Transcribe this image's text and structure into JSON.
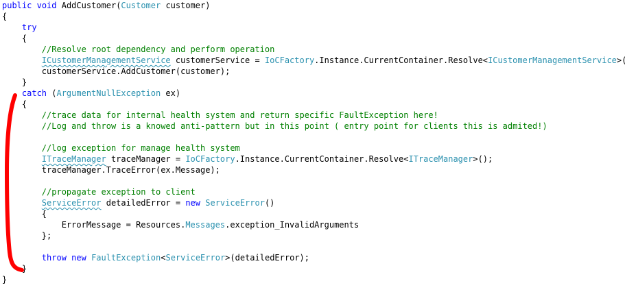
{
  "editor": {
    "indent": "    ",
    "lines": [
      {
        "i": 0,
        "t": [
          {
            "c": "kw",
            "v": "public"
          },
          {
            "v": " "
          },
          {
            "c": "kw",
            "v": "void"
          },
          {
            "v": " AddCustomer("
          },
          {
            "c": "ty",
            "v": "Customer"
          },
          {
            "v": " customer)"
          }
        ]
      },
      {
        "i": 0,
        "t": [
          {
            "v": "{"
          }
        ]
      },
      {
        "i": 1,
        "t": [
          {
            "c": "kw",
            "v": "try"
          }
        ]
      },
      {
        "i": 1,
        "t": [
          {
            "v": "{"
          }
        ]
      },
      {
        "i": 2,
        "t": [
          {
            "c": "cm",
            "v": "//Resolve root dependency and perform operation"
          }
        ]
      },
      {
        "i": 2,
        "t": [
          {
            "c": "ty wavy",
            "v": "ICustomerManagementService"
          },
          {
            "v": " customerService = "
          },
          {
            "c": "ty",
            "v": "IoCFactory"
          },
          {
            "v": ".Instance.CurrentContainer.Resolve<"
          },
          {
            "c": "ty",
            "v": "ICustomerManagementService"
          },
          {
            "v": ">();"
          }
        ]
      },
      {
        "i": 2,
        "t": [
          {
            "v": "customerService.AddCustomer(customer);"
          }
        ]
      },
      {
        "i": 1,
        "t": [
          {
            "v": "}"
          }
        ]
      },
      {
        "i": 1,
        "t": [
          {
            "c": "kw",
            "v": "catch"
          },
          {
            "v": " ("
          },
          {
            "c": "ty",
            "v": "ArgumentNullException"
          },
          {
            "v": " ex)"
          }
        ]
      },
      {
        "i": 1,
        "t": [
          {
            "v": "{"
          }
        ]
      },
      {
        "i": 2,
        "t": [
          {
            "c": "cm",
            "v": "//trace data for internal health system and return specific FaultException here!"
          }
        ]
      },
      {
        "i": 2,
        "t": [
          {
            "c": "cm",
            "v": "//Log and throw is a knowed anti-pattern but in this point ( entry point for clients this is admited!)"
          }
        ]
      },
      {
        "i": 0,
        "t": []
      },
      {
        "i": 2,
        "t": [
          {
            "c": "cm",
            "v": "//log exception for manage health system"
          }
        ]
      },
      {
        "i": 2,
        "t": [
          {
            "c": "ty wavy",
            "v": "ITraceManager"
          },
          {
            "v": " traceManager = "
          },
          {
            "c": "ty",
            "v": "IoCFactory"
          },
          {
            "v": ".Instance.CurrentContainer.Resolve<"
          },
          {
            "c": "ty",
            "v": "ITraceManager"
          },
          {
            "v": ">();"
          }
        ]
      },
      {
        "i": 2,
        "t": [
          {
            "v": "traceManager.TraceError(ex.Message);"
          }
        ]
      },
      {
        "i": 0,
        "t": []
      },
      {
        "i": 2,
        "t": [
          {
            "c": "cm",
            "v": "//propagate exception to client"
          }
        ]
      },
      {
        "i": 2,
        "t": [
          {
            "c": "ty wavy",
            "v": "ServiceError"
          },
          {
            "v": " detailedError = "
          },
          {
            "c": "kw",
            "v": "new"
          },
          {
            "v": " "
          },
          {
            "c": "ty",
            "v": "ServiceError"
          },
          {
            "v": "()"
          }
        ]
      },
      {
        "i": 2,
        "t": [
          {
            "v": "{"
          }
        ]
      },
      {
        "i": 3,
        "t": [
          {
            "v": "ErrorMessage = Resources."
          },
          {
            "c": "ty",
            "v": "Messages"
          },
          {
            "v": ".exception_InvalidArguments"
          }
        ]
      },
      {
        "i": 2,
        "t": [
          {
            "v": "};"
          }
        ]
      },
      {
        "i": 0,
        "t": []
      },
      {
        "i": 2,
        "t": [
          {
            "c": "kw",
            "v": "throw"
          },
          {
            "v": " "
          },
          {
            "c": "kw",
            "v": "new"
          },
          {
            "v": " "
          },
          {
            "c": "ty",
            "v": "FaultException"
          },
          {
            "v": "<"
          },
          {
            "c": "ty",
            "v": "ServiceError"
          },
          {
            "v": ">(detailedError);"
          }
        ]
      },
      {
        "i": 1,
        "t": [
          {
            "v": "}"
          }
        ]
      },
      {
        "i": 0,
        "t": [
          {
            "v": "}"
          }
        ]
      }
    ]
  },
  "colors": {
    "keyword": "#0000ff",
    "type": "#2b91af",
    "comment": "#008000",
    "text": "#000000",
    "annotation": "#ff0000"
  }
}
